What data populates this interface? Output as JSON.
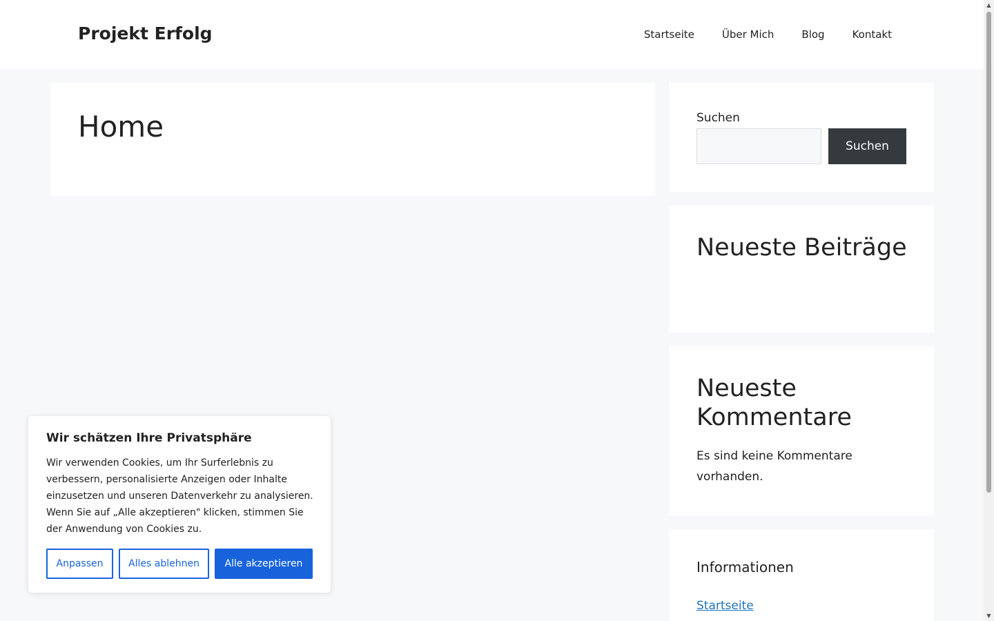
{
  "header": {
    "site_title": "Projekt Erfolg",
    "nav": [
      "Startseite",
      "Über Mich",
      "Blog",
      "Kontakt"
    ]
  },
  "main": {
    "page_title": "Home"
  },
  "sidebar": {
    "search": {
      "label": "Suchen",
      "value": "",
      "placeholder": "",
      "button_label": "Suchen"
    },
    "recent_posts": {
      "heading": "Neueste Beiträge"
    },
    "recent_comments": {
      "heading": "Neueste Kommentare",
      "empty_text": "Es sind keine Kommentare vorhanden."
    },
    "info": {
      "heading": "Informationen",
      "links": [
        "Startseite"
      ]
    }
  },
  "cookie_banner": {
    "title": "Wir schätzen Ihre Privatsphäre",
    "text": "Wir verwenden Cookies, um Ihr Surferlebnis zu verbessern, personalisierte Anzeigen oder Inhalte einzusetzen und unseren Datenverkehr zu analysieren. Wenn Sie auf „Alle akzeptieren\" klicken, stimmen Sie der Anwendung von Cookies zu.",
    "customize_label": "Anpassen",
    "reject_label": "Alles ablehnen",
    "accept_label": "Alle akzeptieren"
  },
  "scrollbar": {
    "up_icon": "▲",
    "down_icon": "▼"
  },
  "colors": {
    "background": "#f7f8f9",
    "card": "#ffffff",
    "text": "#222222",
    "search_button": "#353a3f",
    "link": "#1e73be",
    "cookie_accent": "#1863dc"
  }
}
